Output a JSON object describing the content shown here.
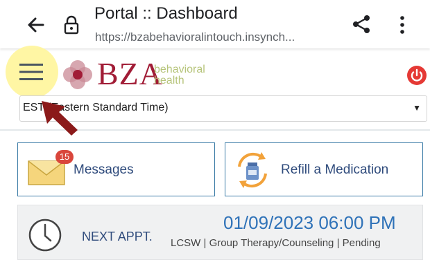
{
  "browser": {
    "title": "Portal :: Dashboard",
    "url": "https://bzabehavioralintouch.insynch..."
  },
  "header": {
    "logo_text": "BZA",
    "logo_sub_line1": "behavioral",
    "logo_sub_line2": "health"
  },
  "timezone": {
    "selected": "EST (Eastern Standard Time)"
  },
  "tiles": {
    "messages": {
      "label": "Messages",
      "badge_count": "15"
    },
    "refill": {
      "label": "Refill a Medication"
    }
  },
  "next_appt": {
    "label": "NEXT APPT.",
    "datetime": "01/09/2023 06:00 PM",
    "detail": "LCSW | Group Therapy/Counseling | Pending"
  },
  "colors": {
    "brand": "#a11c36",
    "accent": "#2f72b8",
    "badge": "#d9463c",
    "power": "#e53935"
  },
  "icons": {
    "back": "arrow-left",
    "lock": "padlock",
    "share": "share-nodes",
    "more": "vertical-dots",
    "menu": "hamburger",
    "power": "power",
    "messages": "envelope",
    "refill": "pill-bottle-cycle",
    "appointment": "clock"
  }
}
